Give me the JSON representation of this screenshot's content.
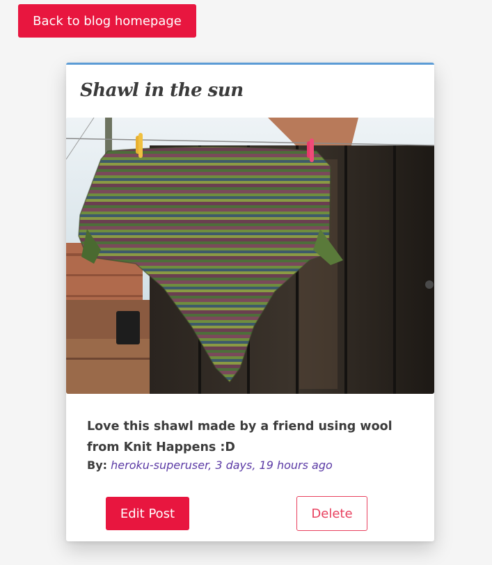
{
  "nav": {
    "back_label": "Back to blog homepage"
  },
  "post": {
    "title": "Shawl in the sun",
    "image_subject": "knitted-striped-shawl-on-washing-line",
    "body": "Love this shawl made by a friend using wool from Knit Happens :D",
    "by_label": "By:",
    "author_meta": "heroku-superuser, 3 days, 19 hours ago"
  },
  "actions": {
    "edit_label": "Edit Post",
    "delete_label": "Delete"
  },
  "colors": {
    "accent": "#e8163f",
    "delete_outline": "#e8405e",
    "card_top_border": "#5b9bd5",
    "author_link": "#5b3aa5",
    "page_background": "#f5f5f5"
  }
}
